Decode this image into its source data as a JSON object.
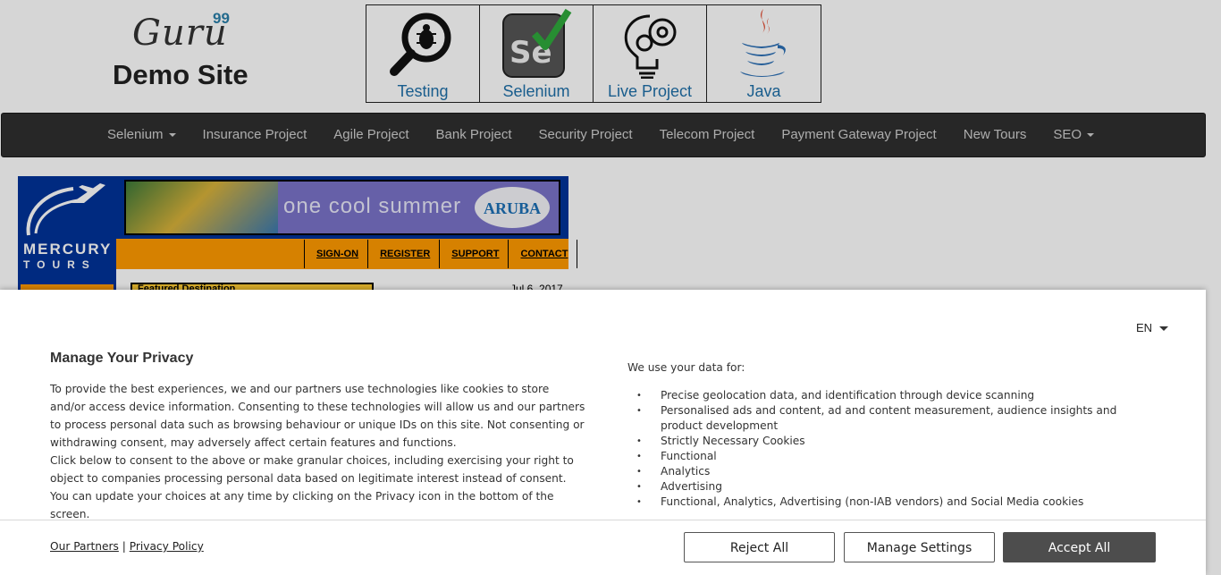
{
  "header": {
    "logo_script": "Guru",
    "logo_superscript": "99",
    "logo_subtitle": "Demo Site",
    "tiles": [
      {
        "label": "Testing",
        "icon": "magnifier-bug-icon"
      },
      {
        "label": "Selenium",
        "icon": "selenium-logo-icon"
      },
      {
        "label": "Live Project",
        "icon": "brain-gear-icon"
      },
      {
        "label": "Java",
        "icon": "java-cup-icon"
      }
    ]
  },
  "navbar": {
    "items": [
      {
        "label": "Selenium",
        "dropdown": true
      },
      {
        "label": "Insurance Project"
      },
      {
        "label": "Agile Project"
      },
      {
        "label": "Bank Project"
      },
      {
        "label": "Security Project"
      },
      {
        "label": "Telecom Project"
      },
      {
        "label": "Payment Gateway Project"
      },
      {
        "label": "New Tours"
      },
      {
        "label": "SEO",
        "dropdown": true
      }
    ]
  },
  "mercury": {
    "logo_word1": "MERCURY",
    "logo_word2": "TOURS",
    "banner_text": "one cool summer",
    "banner_brand": "ARUBA",
    "links": [
      "SIGN-ON",
      "REGISTER",
      "SUPPORT",
      "CONTACT"
    ],
    "featured_label": "Featured Destination",
    "date": "Jul 6, 2017"
  },
  "consent": {
    "language": "EN",
    "title": "Manage Your Privacy",
    "paragraph1": "To provide the best experiences, we and our partners use technologies like cookies to store and/or access device information. Consenting to these technologies will allow us and our partners to process personal data such as browsing behaviour or unique IDs on this site. Not consenting or withdrawing consent, may adversely affect certain features and functions.",
    "paragraph2": "Click below to consent to the above or make granular choices, including exercising your right to object to companies processing personal data based on legitimate interest instead of consent. You can update your choices at any time by clicking on the Privacy icon in the bottom of the screen.",
    "uses_title": "We use your data for:",
    "uses": [
      "Precise geolocation data, and identification through device scanning",
      "Personalised ads and content, ad and content measurement, audience insights and product development",
      "Strictly Necessary Cookies",
      "Functional",
      "Analytics",
      "Advertising",
      "Functional, Analytics, Advertising (non-IAB vendors) and Social Media cookies"
    ],
    "link_partners": "Our Partners",
    "link_separator": "|",
    "link_privacy": "Privacy Policy",
    "btn_reject": "Reject All",
    "btn_manage": "Manage Settings",
    "btn_accept": "Accept All"
  },
  "colors": {
    "navbar_bg": "#2f2f2f",
    "mercury_blue": "#003399",
    "mercury_orange": "#ff9a00",
    "tile_label": "#1e6fa8",
    "accept_bg": "#4d4d4d"
  }
}
